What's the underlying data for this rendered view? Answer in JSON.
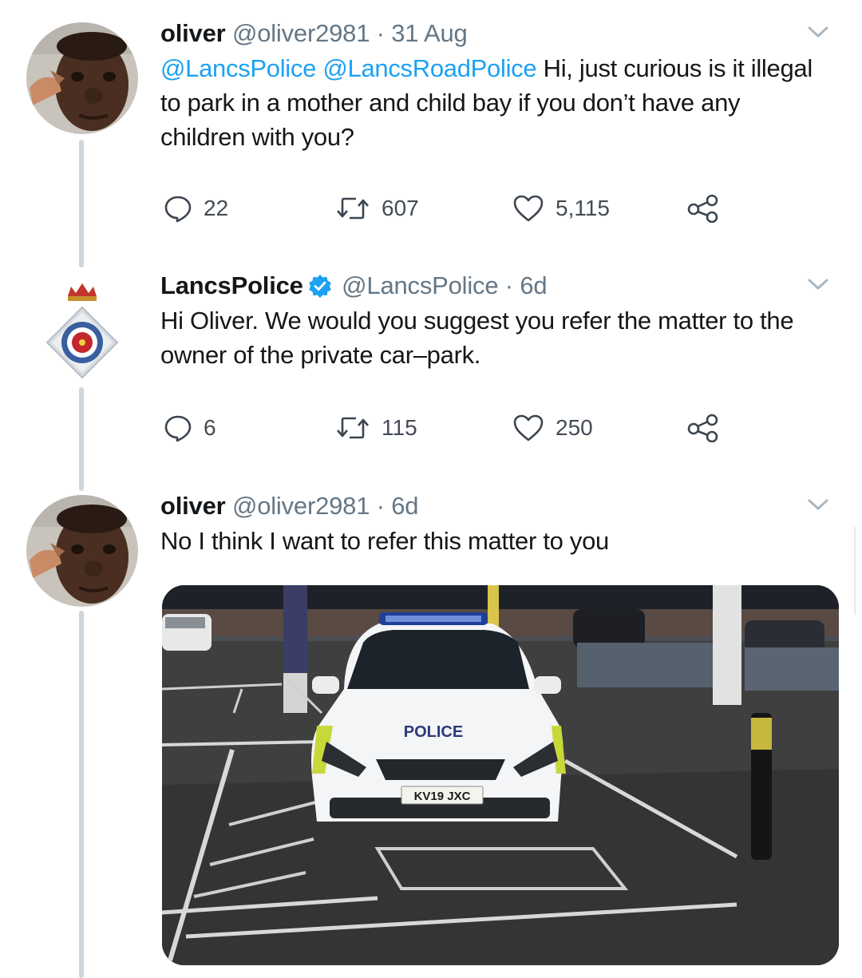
{
  "colors": {
    "link": "#1da1f2",
    "secondary_text": "#657786",
    "thread_line": "#cfd6dc",
    "verified": "#1da1f2"
  },
  "tweets": [
    {
      "display_name": "oliver",
      "handle": "@oliver2981",
      "time": "· 31 Aug",
      "mentions": [
        "@LancsPolice",
        "@LancsRoadPolice"
      ],
      "text": "Hi, just curious is it illegal to park in a mother and child bay if you don’t have any children with you?",
      "replies": "22",
      "retweets": "607",
      "likes": "5,115",
      "avatar_icon": "cartoon-man-avatar"
    },
    {
      "display_name": "LancsPolice",
      "verified": true,
      "handle": "@LancsPolice",
      "time": "· 6d",
      "text": "Hi Oliver. We would you suggest you refer the matter to the owner of the private car–park.",
      "replies": "6",
      "retweets": "115",
      "likes": "250",
      "avatar_icon": "police-crest-avatar"
    },
    {
      "display_name": "oliver",
      "handle": "@oliver2981",
      "time": "· 6d",
      "text": "No I think I want to refer this matter to you",
      "avatar_icon": "cartoon-man-avatar"
    }
  ],
  "photo": {
    "police_text": "POLICE",
    "plate": "KV19 JXC"
  },
  "icons": {
    "reply": "reply-icon",
    "retweet": "retweet-icon",
    "like": "heart-icon",
    "share": "share-icon",
    "menu": "chevron-down-icon",
    "verified": "verified-badge-icon"
  }
}
